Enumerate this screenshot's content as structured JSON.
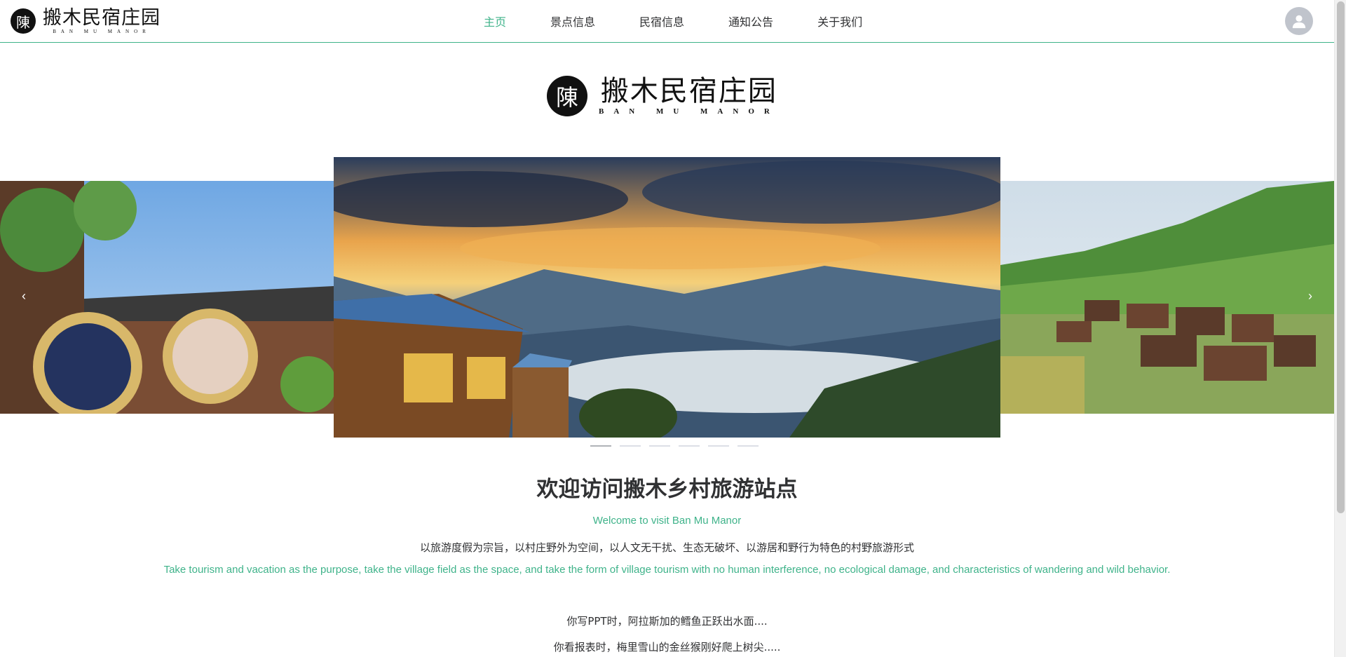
{
  "header": {
    "logo_glyph": "陳",
    "logo_cn": "搬木民宿庄园",
    "logo_en": "BAN MU MANOR",
    "nav": [
      {
        "label": "主页",
        "active": true
      },
      {
        "label": "景点信息",
        "active": false
      },
      {
        "label": "民宿信息",
        "active": false
      },
      {
        "label": "通知公告",
        "active": false
      },
      {
        "label": "关于我们",
        "active": false
      }
    ],
    "avatar_icon": "user-icon"
  },
  "brand": {
    "glyph": "陳",
    "cn": "搬木民宿庄园",
    "en": "BAN MU MANOR"
  },
  "carousel": {
    "prev_icon": "chevron-left-icon",
    "next_icon": "chevron-right-icon",
    "prev_glyph": "‹",
    "next_glyph": "›",
    "slide_count": 6,
    "active_index": 0
  },
  "welcome": {
    "title": "欢迎访问搬木乡村旅游站点",
    "subtitle_en": "Welcome to visit Ban Mu Manor",
    "desc_cn": "以旅游度假为宗旨，以村庄野外为空间，以人文无干扰、生态无破坏、以游居和野行为特色的村野旅游形式",
    "desc_en": "Take tourism and vacation as the purpose, take the village field as the space, and take the form of village tourism with no human interference, no ecological damage, and characteristics of wandering and wild behavior.",
    "line1": "你写PPT时，阿拉斯加的鳕鱼正跃出水面....",
    "line2": "你看报表时，梅里雪山的金丝猴刚好爬上树尖....."
  },
  "colors": {
    "accent": "#3fb38a",
    "text": "#303133"
  }
}
